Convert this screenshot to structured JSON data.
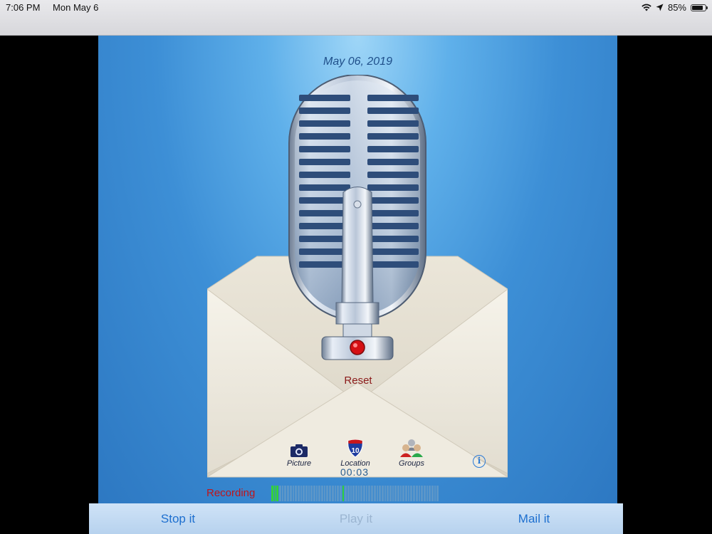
{
  "status_bar": {
    "time": "7:06 PM",
    "date": "Mon May 6",
    "battery_percent": "85%",
    "battery_level": 0.85,
    "icons": [
      "wifi-icon",
      "location-arrow-icon",
      "battery-icon"
    ]
  },
  "app": {
    "date": "May 06, 2019",
    "reset_label": "Reset",
    "tools": {
      "picture": "Picture",
      "location": "Location",
      "location_badge": "10",
      "groups": "Groups"
    },
    "timer": "00:03",
    "info_label": "i",
    "recording_label": "Recording",
    "meter": {
      "bar_count": 64,
      "active_bars": [
        0,
        1,
        2,
        27
      ]
    },
    "colors": {
      "recording": "#c0151a",
      "meter_active": "#34d23a",
      "accent": "#1d6fcf"
    }
  },
  "toolbar": {
    "stop_label": "Stop it",
    "play_label": "Play it",
    "mail_label": "Mail it"
  }
}
